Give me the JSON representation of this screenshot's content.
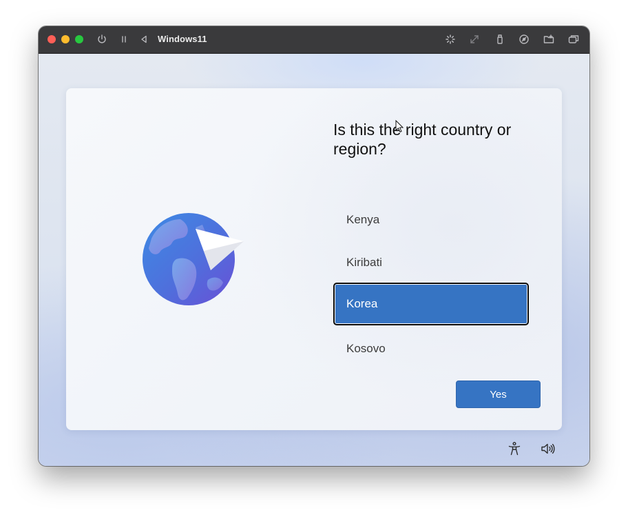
{
  "window": {
    "title": "Windows11"
  },
  "toolbar": {
    "left_icons": [
      "power-icon",
      "pause-icon",
      "back-icon"
    ],
    "right_icons": [
      "loading-icon",
      "resize-icon",
      "usb-icon",
      "disc-icon",
      "shared-folder-icon",
      "windows-icon"
    ]
  },
  "setup": {
    "question": "Is this the right country or region?",
    "regions": [
      {
        "label": "Kenya",
        "selected": false
      },
      {
        "label": "Kiribati",
        "selected": false
      },
      {
        "label": "Korea",
        "selected": true
      },
      {
        "label": "Kosovo",
        "selected": false
      }
    ],
    "confirm_label": "Yes"
  },
  "footer": {
    "icons": [
      "accessibility-icon",
      "volume-icon"
    ]
  },
  "colors": {
    "accent": "#3674c3",
    "titlebar": "#3a3a3c",
    "close": "#ff5f57",
    "minimize": "#febc2e",
    "maximize": "#28c840"
  }
}
